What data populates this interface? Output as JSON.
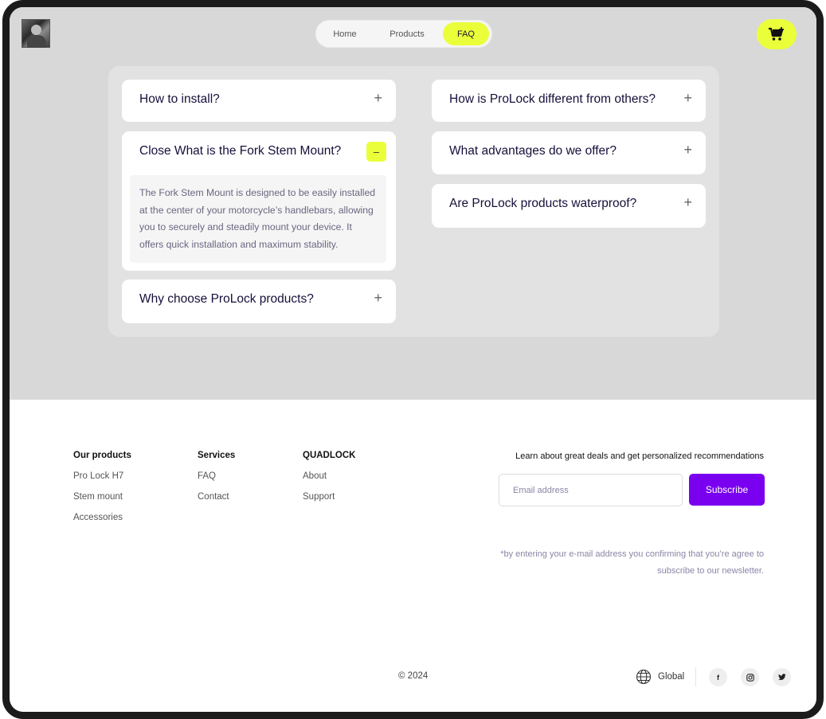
{
  "nav": {
    "home": "Home",
    "products": "Products",
    "faq": "FAQ"
  },
  "icons": {
    "cart": "cart-plus-icon",
    "globe": "globe-icon",
    "facebook": "facebook-icon",
    "instagram": "instagram-icon",
    "twitter": "twitter-icon"
  },
  "colors": {
    "accent": "#eaff3a",
    "purple": "#7a00f0",
    "top_bg": "#d8d8d8"
  },
  "faq": {
    "left": [
      {
        "question": "How to install?",
        "expanded": false
      },
      {
        "question": "Close What is the Fork Stem Mount?",
        "expanded": true,
        "answer": "The Fork Stem Mount is designed to be easily installed at the center of your motorcycle’s handlebars, allowing you to securely and steadily mount your device. It offers quick installation and maximum stability."
      },
      {
        "question": "Why choose ProLock products?",
        "expanded": false
      }
    ],
    "right": [
      {
        "question": "How is ProLock different from others?",
        "expanded": false
      },
      {
        "question": "What advantages do we offer?",
        "expanded": false
      },
      {
        "question": "Are ProLock products waterproof?",
        "expanded": false
      }
    ],
    "plus_symbol": "+",
    "minus_symbol": "–"
  },
  "footer": {
    "columns": [
      {
        "title": "Our products",
        "links": [
          "Pro Lock H7",
          "Stem mount",
          "Accessories"
        ]
      },
      {
        "title": "Services",
        "links": [
          "FAQ",
          "Contact"
        ]
      },
      {
        "title": "QUADLOCK",
        "links": [
          "About",
          "Support"
        ]
      }
    ],
    "newsletter": {
      "heading": "Learn about great deals and get personalized recommendations",
      "email_placeholder": "Email address",
      "button": "Subscribe",
      "note": "*by entering your e-mail address you confirming that you’re agree to subscribe to our newsletter."
    },
    "copyright": "© 2024",
    "region": "Global",
    "social": {
      "facebook": "f",
      "instagram": "◎",
      "twitter": "🐦"
    }
  }
}
